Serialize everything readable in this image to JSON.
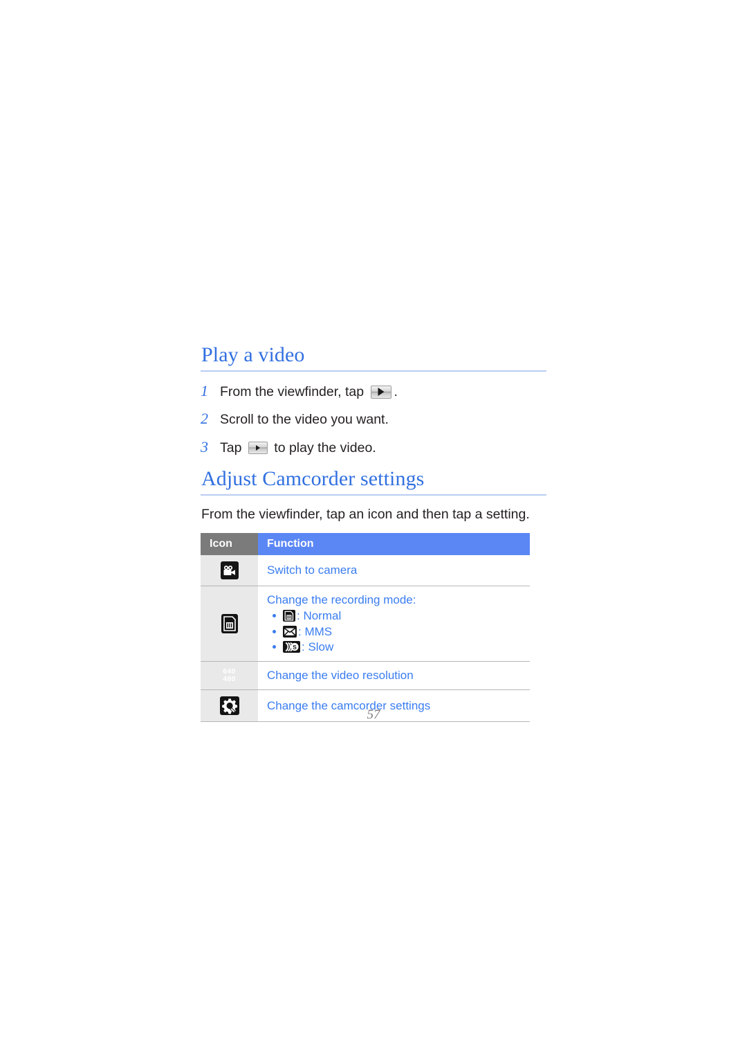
{
  "document": {
    "page_number": "57"
  },
  "sections": [
    {
      "heading": "Play a video",
      "steps": [
        {
          "number": "1",
          "before": "From the viewfinder, tap ",
          "icon": "play-button-icon",
          "after": "."
        },
        {
          "number": "2",
          "before": "Scroll to the video you want.",
          "icon": null,
          "after": ""
        },
        {
          "number": "3",
          "before": "Tap ",
          "icon": "play-button-icon",
          "after": " to play the video."
        }
      ]
    },
    {
      "heading": "Adjust Camcorder settings",
      "intro": "From the viewfinder, tap an icon and then tap a setting.",
      "table": {
        "headers": {
          "icon": "Icon",
          "function": "Function"
        },
        "rows": [
          {
            "icon": "camcorder-icon",
            "function": "Switch to camera",
            "bullets": []
          },
          {
            "icon": "recording-mode-icon",
            "function": "Change the recording mode:",
            "bullets": [
              {
                "icon": "normal-mode-icon",
                "label": ": Normal"
              },
              {
                "icon": "mms-mode-icon",
                "label": ": MMS"
              },
              {
                "icon": "slow-mode-icon",
                "label": ": Slow"
              }
            ]
          },
          {
            "icon": "video-resolution-icon",
            "resolution_top": "640",
            "resolution_bottom": "480",
            "function": "Change the video resolution",
            "bullets": []
          },
          {
            "icon": "camcorder-settings-icon",
            "function": "Change the camcorder settings",
            "bullets": []
          }
        ]
      }
    }
  ],
  "colors": {
    "heading_blue": "#3270e0",
    "table_header_blue": "#5b87f5",
    "table_header_grey": "#7b7b7b",
    "link_blue": "#3a7df0",
    "body_text": "#231f20",
    "icon_cell_bg": "#e9e9e9",
    "page_number_grey": "#7a7a7a"
  }
}
